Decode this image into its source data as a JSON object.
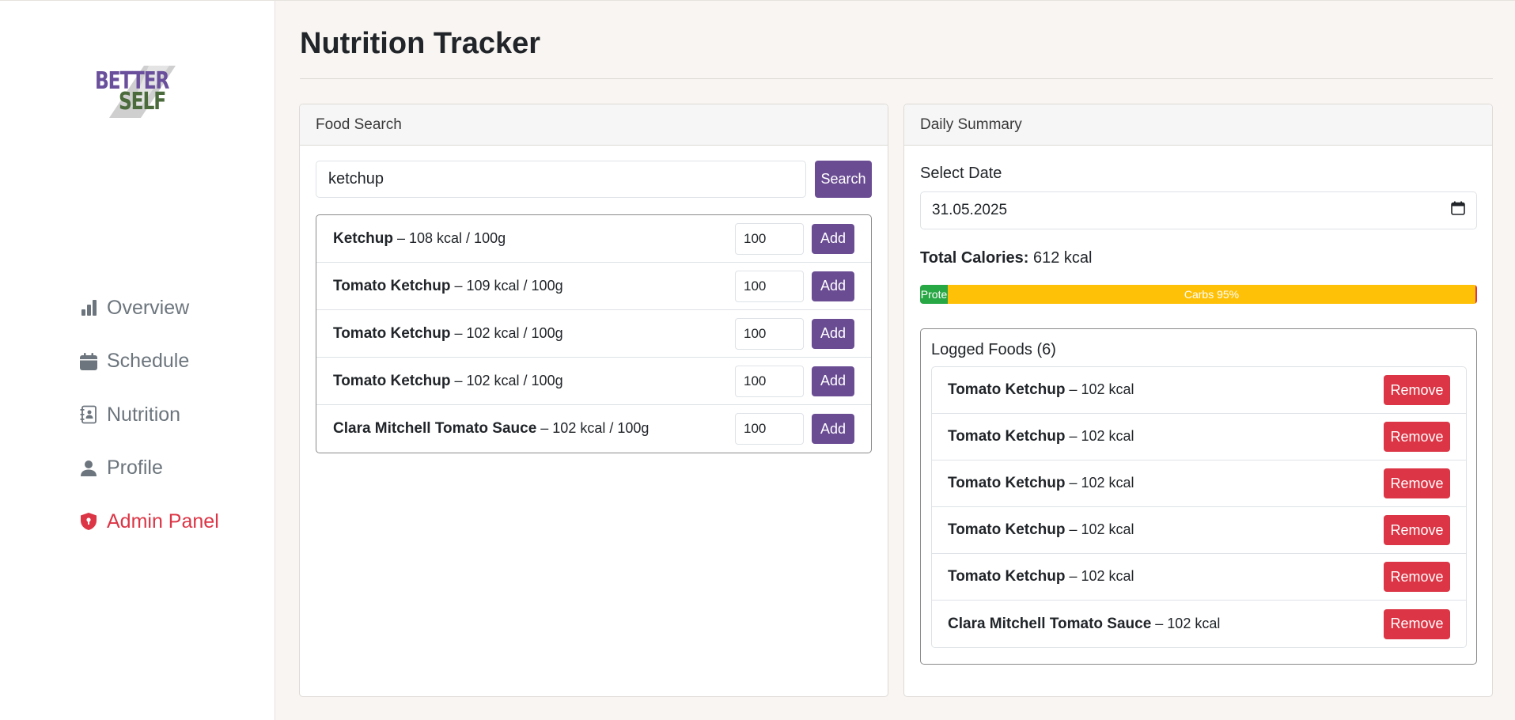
{
  "brand": {
    "line1": "BETTER",
    "line2": "SELF"
  },
  "nav": {
    "items": [
      {
        "label": "Overview",
        "icon": "bar-chart-icon"
      },
      {
        "label": "Schedule",
        "icon": "calendar-icon"
      },
      {
        "label": "Nutrition",
        "icon": "notebook-icon"
      },
      {
        "label": "Profile",
        "icon": "person-icon"
      }
    ],
    "admin": {
      "label": "Admin Panel",
      "icon": "shield-icon"
    }
  },
  "page": {
    "title": "Nutrition Tracker"
  },
  "food_search": {
    "header": "Food Search",
    "query": "ketchup",
    "search_label": "Search",
    "add_label": "Add",
    "results": [
      {
        "name": "Ketchup",
        "detail": " – 108 kcal / 100g",
        "qty": "100"
      },
      {
        "name": "Tomato Ketchup",
        "detail": " – 109 kcal / 100g",
        "qty": "100"
      },
      {
        "name": "Tomato Ketchup",
        "detail": " – 102 kcal / 100g",
        "qty": "100"
      },
      {
        "name": "Tomato Ketchup",
        "detail": " – 102 kcal / 100g",
        "qty": "100"
      },
      {
        "name": "Clara Mitchell Tomato Sauce",
        "detail": " – 102 kcal / 100g",
        "qty": "100"
      }
    ]
  },
  "summary": {
    "header": "Daily Summary",
    "date_label": "Select Date",
    "date_value": "31.05.2025",
    "total_label": "Total Calories:",
    "total_value": " 612 kcal",
    "macros": {
      "protein": {
        "label": "Prote",
        "percent": 5,
        "color": "#28a745"
      },
      "carbs": {
        "label": "Carbs 95%",
        "percent": 95,
        "color": "#ffc107"
      },
      "fat": {
        "percent": 0.3,
        "color": "#dc3545"
      }
    },
    "logged_title": "Logged Foods (6)",
    "remove_label": "Remove",
    "logged": [
      {
        "name": "Tomato Ketchup",
        "detail": " – 102 kcal"
      },
      {
        "name": "Tomato Ketchup",
        "detail": " – 102 kcal"
      },
      {
        "name": "Tomato Ketchup",
        "detail": " – 102 kcal"
      },
      {
        "name": "Tomato Ketchup",
        "detail": " – 102 kcal"
      },
      {
        "name": "Tomato Ketchup",
        "detail": " – 102 kcal"
      },
      {
        "name": "Clara Mitchell Tomato Sauce",
        "detail": " – 102 kcal"
      }
    ]
  },
  "colors": {
    "accent": "#6a4c93",
    "danger": "#dc3545",
    "muted": "#6c757d"
  }
}
